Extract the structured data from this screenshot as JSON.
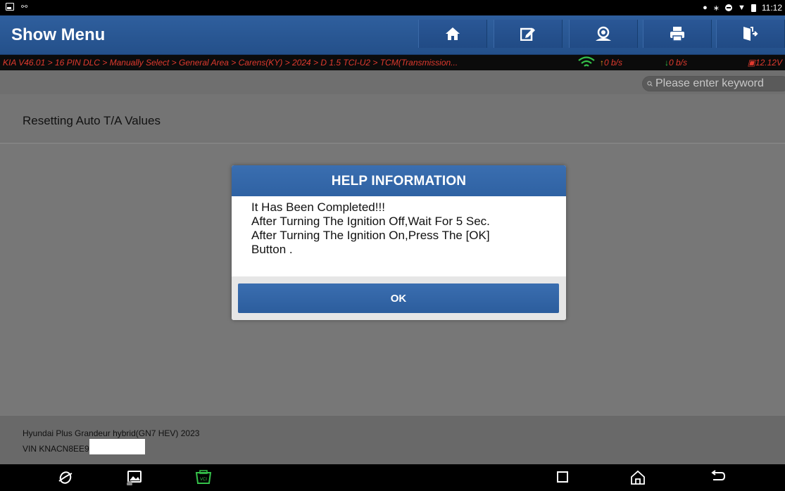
{
  "status_bar": {
    "time": "11:12",
    "icons": [
      "image-notification-icon",
      "usb-debug-icon",
      "location-icon",
      "bluetooth-icon",
      "do-not-disturb-icon",
      "wifi-icon",
      "battery-icon"
    ]
  },
  "header": {
    "title": "Show Menu",
    "toolbar": [
      "home-icon",
      "edit-report-icon",
      "support-icon",
      "print-icon",
      "exit-icon"
    ],
    "accent": "#2b5a99"
  },
  "breadcrumb": {
    "path": "KIA V46.01 > 16 PIN DLC > Manually Select > General Area > Carens(KY) > 2024 > D 1.5 TCI-U2 > TCM(Transmission...",
    "upload_rate": "0 b/s",
    "download_rate": "0 b/s",
    "voltage": "12.12V",
    "text_color": "#e03a2e"
  },
  "search": {
    "placeholder": "Please enter keyword"
  },
  "section": {
    "title": "Resetting Auto T/A Values"
  },
  "dialog": {
    "title": "HELP INFORMATION",
    "lines": [
      "It Has Been Completed!!!",
      "After Turning The Ignition Off,Wait For 5 Sec.",
      "After Turning The Ignition On,Press The [OK]",
      "Button ."
    ],
    "ok_label": "OK"
  },
  "vehicle": {
    "model": "Hyundai Plus Grandeur hybrid(GN7 HEV) 2023",
    "vin": "VIN KNACN8EE9"
  },
  "nav_bar": [
    "browser-icon",
    "gallery-icon",
    "vci-icon",
    "recents-icon",
    "home-icon",
    "back-icon"
  ]
}
